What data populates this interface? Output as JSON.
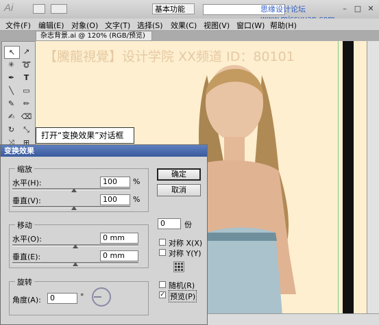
{
  "titlebar": {
    "app_logo": "Ai",
    "workspace": "基本功能",
    "watermark": "思缘设计论坛 www.missyuan.com",
    "window_controls": [
      "–",
      "□",
      "✕"
    ]
  },
  "menubar": {
    "items": [
      "文件(F)",
      "编辑(E)",
      "对象(O)",
      "文字(T)",
      "选择(S)",
      "效果(C)",
      "视图(V)",
      "窗口(W)",
      "帮助(H)"
    ]
  },
  "document": {
    "tab_title": "杂志背景.ai @ 120% (RGB/预览)",
    "canvas_watermark": "【騰龍視覺】设计学院 XX频道 ID：80101"
  },
  "callout": {
    "text": "打开“变换效果”对话框"
  },
  "dialog": {
    "title": "变换效果",
    "scale_group": {
      "label": "缩放",
      "horizontal_label": "水平(H):",
      "horizontal_value": "100",
      "vertical_label": "垂直(V):",
      "vertical_value": "100",
      "unit": "%"
    },
    "move_group": {
      "label": "移动",
      "horizontal_label": "水平(O):",
      "horizontal_value": "0 mm",
      "vertical_label": "垂直(E):",
      "vertical_value": "0 mm"
    },
    "rotate_group": {
      "label": "旋转",
      "angle_label": "角度(A):",
      "angle_value": "0",
      "degree": "°"
    },
    "ok_label": "确定",
    "cancel_label": "取消",
    "copies_value": "0",
    "copies_unit": "份",
    "reflect_x_label": "对称 X(X)",
    "reflect_y_label": "对称 Y(Y)",
    "random_label": "随机(R)",
    "preview_label": "预览(P)",
    "preview_checked": "✓"
  }
}
